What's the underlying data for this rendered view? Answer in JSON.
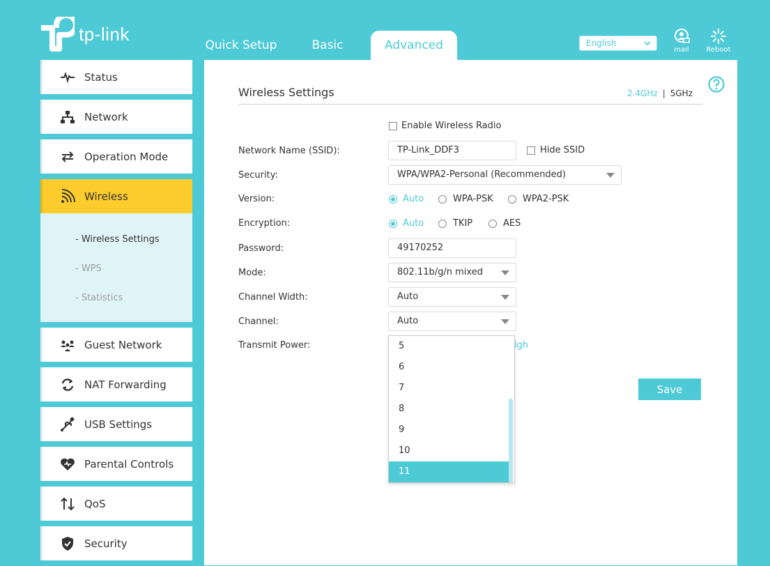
{
  "brand": {
    "name": "tp-link"
  },
  "topnav": {
    "tabs": [
      {
        "label": "Quick Setup"
      },
      {
        "label": "Basic"
      },
      {
        "label": "Advanced"
      }
    ],
    "active": "Advanced"
  },
  "header": {
    "language": "English",
    "mail_label": "mail",
    "reboot_label": "Reboot"
  },
  "sidebar": {
    "items": [
      {
        "label": "Status",
        "icon": "pulse-icon"
      },
      {
        "label": "Network",
        "icon": "network-icon"
      },
      {
        "label": "Operation Mode",
        "icon": "switch-arrows-icon"
      },
      {
        "label": "Wireless",
        "icon": "wifi-icon"
      },
      {
        "label": "Guest Network",
        "icon": "guest-icon"
      },
      {
        "label": "NAT Forwarding",
        "icon": "refresh-icon"
      },
      {
        "label": "USB Settings",
        "icon": "usb-icon"
      },
      {
        "label": "Parental Controls",
        "icon": "heart-icon"
      },
      {
        "label": "QoS",
        "icon": "updown-arrows-icon"
      },
      {
        "label": "Security",
        "icon": "shield-icon"
      }
    ],
    "wireless_sub": [
      {
        "label": "- Wireless Settings"
      },
      {
        "label": "- WPS"
      },
      {
        "label": "- Statistics"
      }
    ]
  },
  "colors": {
    "accent": "#4dcad6",
    "active_menu": "#fccc2c",
    "submenu_bg": "#dff4f7"
  },
  "form": {
    "title": "Wireless Settings",
    "band_24": "2.4GHz",
    "band_sep": "|",
    "band_5": "5GHz",
    "enable_radio": "Enable Wireless Radio",
    "ssid_label": "Network Name (SSID):",
    "ssid_value": "TP-Link_DDF3",
    "hide_ssid": "Hide SSID",
    "security_label": "Security:",
    "security_value": "WPA/WPA2-Personal (Recommended)",
    "version_label": "Version:",
    "version_options": [
      "Auto",
      "WPA-PSK",
      "WPA2-PSK"
    ],
    "encryption_label": "Encryption:",
    "encryption_options": [
      "Auto",
      "TKIP",
      "AES"
    ],
    "password_label": "Password:",
    "password_value": "49170252",
    "mode_label": "Mode:",
    "mode_value": "802.11b/g/n mixed",
    "channel_width_label": "Channel Width:",
    "channel_width_value": "Auto",
    "channel_label": "Channel:",
    "channel_value": "Auto",
    "transmit_label": "Transmit Power:",
    "transmit_peek": "igh",
    "save_label": "Save"
  },
  "channel_dropdown": {
    "options": [
      "5",
      "6",
      "7",
      "8",
      "9",
      "10",
      "11"
    ],
    "selected": "11"
  }
}
